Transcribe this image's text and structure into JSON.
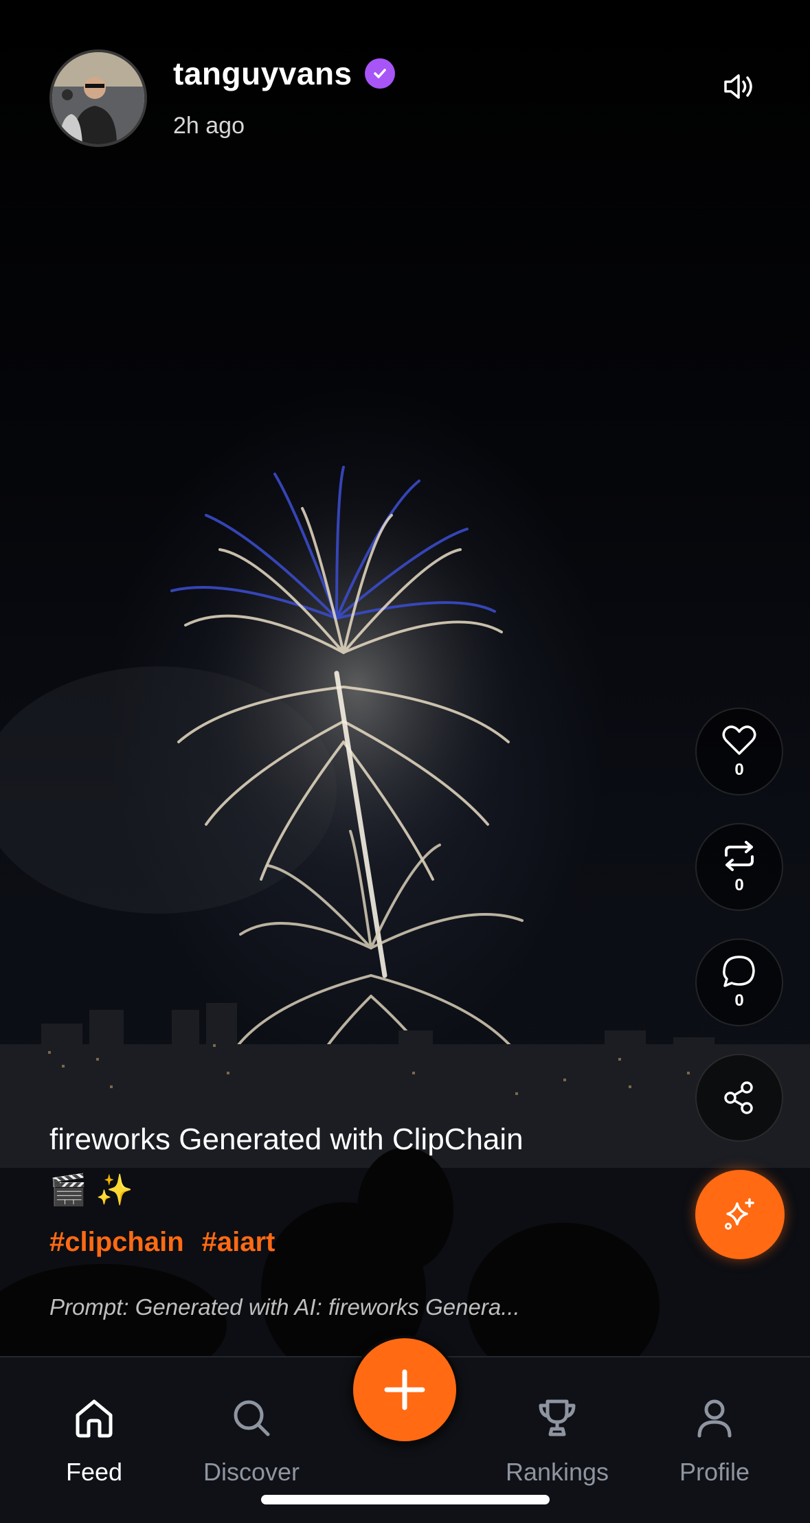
{
  "post": {
    "username": "tanguyvans",
    "time": "2h ago",
    "caption_line1": "fireworks Generated with ClipChain",
    "caption_line2": "🎬 ✨",
    "hashtags": [
      "#clipchain",
      "#aiart"
    ],
    "prompt": "Prompt: Generated with AI: fireworks Genera..."
  },
  "actions": {
    "likes": "0",
    "reposts": "0",
    "comments": "0"
  },
  "nav": {
    "items": [
      {
        "label": "Feed",
        "icon": "home-icon"
      },
      {
        "label": "Discover",
        "icon": "search-icon"
      },
      {
        "label": "Rankings",
        "icon": "trophy-icon"
      },
      {
        "label": "Profile",
        "icon": "user-icon"
      }
    ],
    "active": "Feed"
  },
  "colors": {
    "accent": "#ff6a13",
    "verified": "#a855f7",
    "nav_bg": "#0f1116"
  }
}
